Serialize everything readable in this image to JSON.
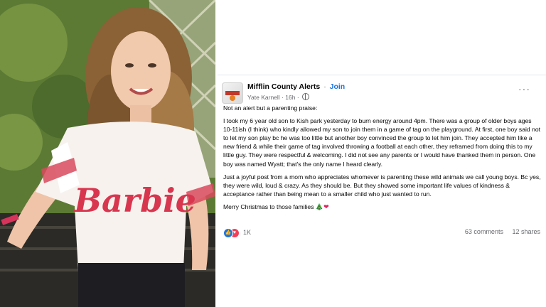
{
  "post": {
    "group_name": "Mifflin County Alerts",
    "join_label": "Join",
    "separator": "·",
    "author": "Yate Karnell",
    "time": "16h",
    "more_icon": "more-options-icon",
    "paragraphs": [
      "Not an alert but a parenting praise:",
      "I took my 6 year old son to Kish park yesterday to burn energy around 4pm. There was a group of older boys ages 10-11ish (I think) who kindly allowed my son to join them in a game of tag on the playground. At first, one boy said not to let my son play bc he was too little but another boy convinced the group to let him join. They accepted him like a new friend & while their game of tag involved throwing a football at each other, they reframed from doing this to my little guy. They were respectful & welcoming. I did not see any parents or I would have thanked them in person. One boy was named Wyatt; that's the only name I heard clearly.",
      "Just a joyful post from a mom who appreciates whomever is parenting these wild animals we call young boys. Bc yes, they were wild, loud & crazy. As they should be. But they showed some important life values of kindness & acceptance rather than being mean to a smaller child who just wanted to run."
    ],
    "closing": "Merry Christmas to those families",
    "closing_emojis": {
      "tree": "🎄",
      "heart": "❤"
    },
    "reactions_count": "1K",
    "comments": "63 comments",
    "shares": "12 shares"
  },
  "colors": {
    "join_blue": "#1b74e4",
    "secondary_text": "#65676b",
    "like_blue": "#1b74e4",
    "love_red": "#f33e58"
  },
  "photo": {
    "shirt_text": "Barbie"
  }
}
